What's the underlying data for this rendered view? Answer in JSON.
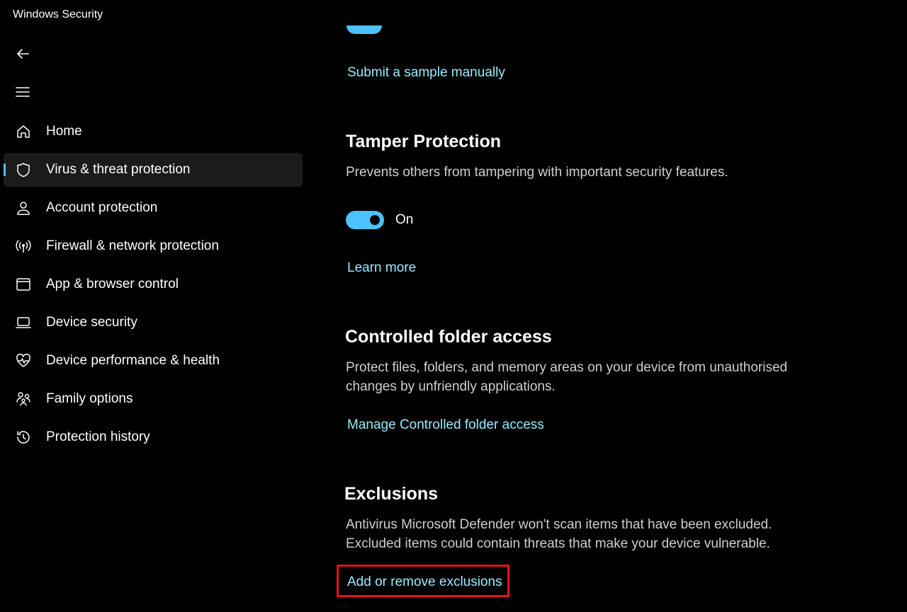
{
  "window": {
    "title": "Windows Security"
  },
  "colors": {
    "accent": "#4cc2ff",
    "link": "#99ebff",
    "highlight": "#e8101a"
  },
  "sidebar": {
    "items": [
      {
        "label": "Home",
        "icon": "home-icon",
        "active": false
      },
      {
        "label": "Virus & threat protection",
        "icon": "shield-icon",
        "active": true
      },
      {
        "label": "Account protection",
        "icon": "person-icon",
        "active": false
      },
      {
        "label": "Firewall & network protection",
        "icon": "wifi-signal-icon",
        "active": false
      },
      {
        "label": "App & browser control",
        "icon": "browser-window-icon",
        "active": false
      },
      {
        "label": "Device security",
        "icon": "laptop-icon",
        "active": false
      },
      {
        "label": "Device performance & health",
        "icon": "heart-pulse-icon",
        "active": false
      },
      {
        "label": "Family options",
        "icon": "family-icon",
        "active": false
      },
      {
        "label": "Protection history",
        "icon": "history-icon",
        "active": false
      }
    ]
  },
  "main": {
    "submit_sample_link": "Submit a sample manually",
    "tamper": {
      "title": "Tamper Protection",
      "description": "Prevents others from tampering with important security features.",
      "toggle_state": "On",
      "learn_more": "Learn more"
    },
    "cfa": {
      "title": "Controlled folder access",
      "description": "Protect files, folders, and memory areas on your device from unauthorised changes by unfriendly applications.",
      "link": "Manage Controlled folder access"
    },
    "exclusions": {
      "title": "Exclusions",
      "description": "Antivirus Microsoft Defender won't scan items that have been excluded. Excluded items could contain threats that make your device vulnerable.",
      "link": "Add or remove exclusions"
    }
  }
}
